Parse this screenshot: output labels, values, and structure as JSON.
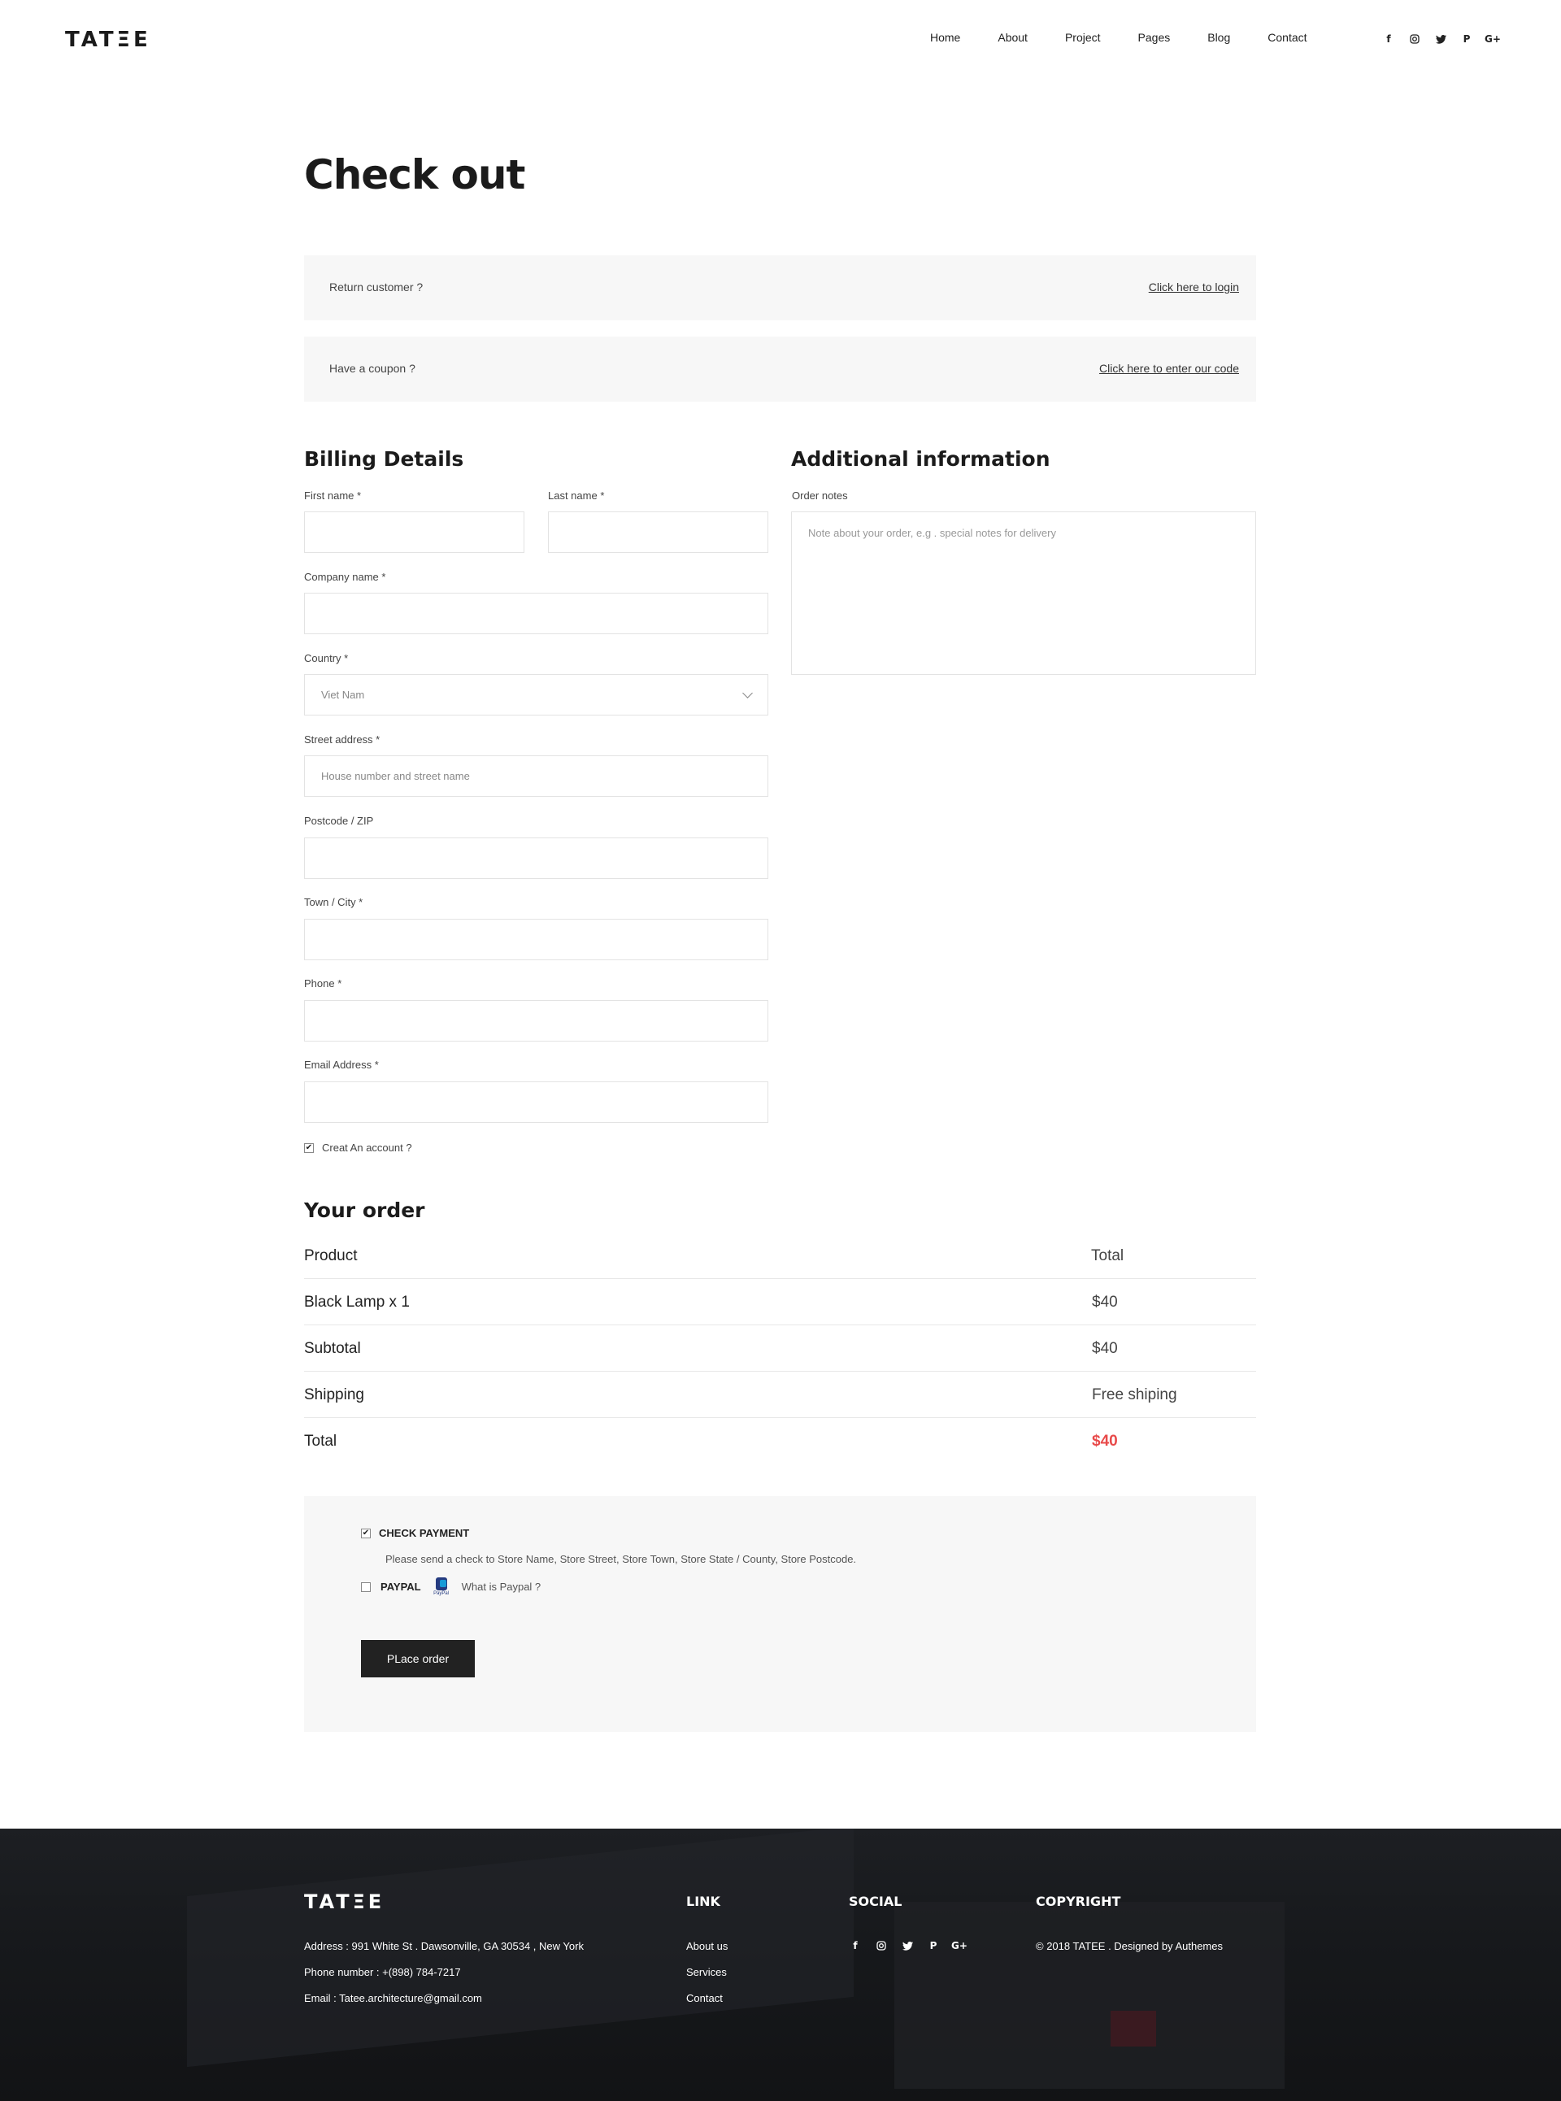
{
  "header": {
    "logo": "TATΞE",
    "nav": [
      "Home",
      "About",
      "Project",
      "Pages",
      "Blog",
      "Contact"
    ],
    "social_icons": [
      "f",
      "◎",
      "🐦",
      "P",
      "G+"
    ]
  },
  "page_title": "Check out",
  "notices": {
    "return_customer": "Return customer ?",
    "login_link": "Click here to login",
    "coupon": "Have a coupon ?",
    "coupon_link": "Click here to enter our code"
  },
  "billing": {
    "title": "Billing Details",
    "first_name": "First name *",
    "last_name": "Last name *",
    "company": "Company name *",
    "country": "Country *",
    "country_value": "Viet Nam",
    "street": "Street address *",
    "street_placeholder": "House number and street name",
    "postcode": "Postcode / ZIP",
    "town": "Town / City *",
    "phone": "Phone *",
    "email": "Email Address *",
    "create_account": "Creat An account ?"
  },
  "additional": {
    "title": "Additional information",
    "order_notes": "Order notes",
    "order_notes_placeholder": "Note about your order, e.g . special notes for delivery"
  },
  "order": {
    "title": "Your order",
    "rows": [
      {
        "label": "Product",
        "value": "Total"
      },
      {
        "label": "Black Lamp x 1",
        "value": "$40"
      },
      {
        "label": "Subtotal",
        "value": "$40"
      },
      {
        "label": "Shipping",
        "value": "Free shiping"
      },
      {
        "label": "Total",
        "value": "$40"
      }
    ]
  },
  "payment": {
    "check_label": "CHECK PAYMENT",
    "check_desc": "Please send a check to Store Name, Store Street, Store Town, Store State / County, Store Postcode.",
    "paypal_label": "PAYPAL",
    "paypal_logo_text": "PayPal",
    "paypal_link": "What is Paypal ?",
    "place_order": "PLace order"
  },
  "footer": {
    "logo": "TATΞE",
    "address": "Address :  991 White St . Dawsonville, GA 30534 , New York",
    "phone": "Phone number :  +(898) 784-7217",
    "email": "Email :  Tatee.architecture@gmail.com",
    "link_title": "LINK",
    "links": [
      "About us",
      "Services",
      "Contact"
    ],
    "social_title": "SOCIAL",
    "copyright_title": "COPYRIGHT",
    "copyright": "© 2018 TATEE . Designed by Authemes"
  },
  "colors": {
    "accent_red": "#e84a4a",
    "dark": "#222222",
    "panel": "#f7f7f7"
  }
}
